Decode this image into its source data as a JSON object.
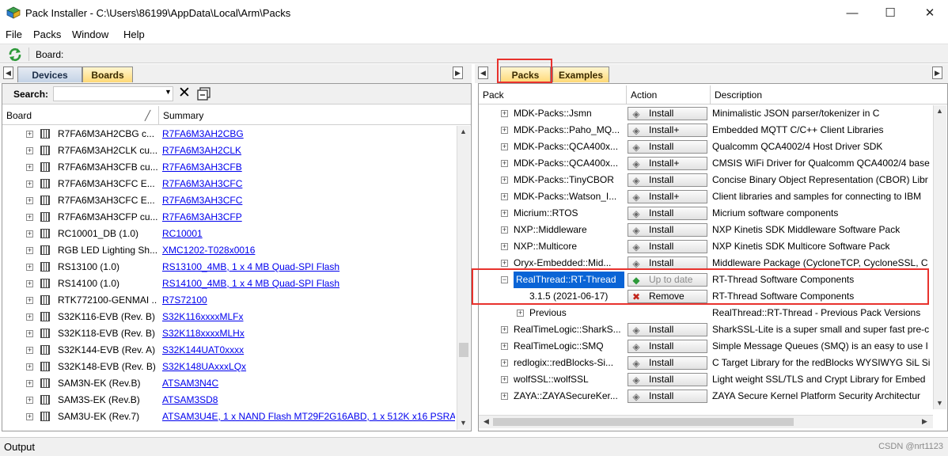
{
  "window": {
    "title": "Pack Installer - C:\\Users\\86199\\AppData\\Local\\Arm\\Packs",
    "minimize": "—",
    "maximize": "☐",
    "close": "✕"
  },
  "menu": [
    "File",
    "Packs",
    "Window",
    "Help"
  ],
  "toolbar": {
    "board_label": "Board:"
  },
  "left_pane": {
    "tabs": [
      "Devices",
      "Boards"
    ],
    "active_tab": "Boards",
    "search_label": "Search:",
    "search_value": "",
    "columns": [
      "Board",
      "Summary"
    ],
    "rows": [
      {
        "board": "R7FA6M3AH2CBG c...",
        "summary": "R7FA6M3AH2CBG"
      },
      {
        "board": "R7FA6M3AH2CLK cu...",
        "summary": "R7FA6M3AH2CLK"
      },
      {
        "board": "R7FA6M3AH3CFB cu...",
        "summary": "R7FA6M3AH3CFB"
      },
      {
        "board": "R7FA6M3AH3CFC E...",
        "summary": "R7FA6M3AH3CFC"
      },
      {
        "board": "R7FA6M3AH3CFC E...",
        "summary": "R7FA6M3AH3CFC"
      },
      {
        "board": "R7FA6M3AH3CFP cu...",
        "summary": "R7FA6M3AH3CFP"
      },
      {
        "board": "RC10001_DB (1.0)",
        "summary": "RC10001"
      },
      {
        "board": "RGB LED Lighting Sh...",
        "summary": "XMC1202-T028x0016"
      },
      {
        "board": "RS13100 (1.0)",
        "summary": "RS13100_4MB, 1 x 4 MB Quad-SPI Flash"
      },
      {
        "board": "RS14100 (1.0)",
        "summary": "RS14100_4MB, 1 x 4 MB Quad-SPI Flash"
      },
      {
        "board": "RTK772100-GENMAI ...",
        "summary": "R7S72100"
      },
      {
        "board": "S32K116-EVB (Rev. B)",
        "summary": "S32K116xxxxMLFx"
      },
      {
        "board": "S32K118-EVB (Rev. B)",
        "summary": "S32K118xxxxMLHx"
      },
      {
        "board": "S32K144-EVB (Rev. A)",
        "summary": "S32K144UAT0xxxx"
      },
      {
        "board": "S32K148-EVB (Rev. B)",
        "summary": "S32K148UAxxxLQx"
      },
      {
        "board": "SAM3N-EK (Rev.B)",
        "summary": "ATSAM3N4C"
      },
      {
        "board": "SAM3S-EK (Rev.B)",
        "summary": "ATSAM3SD8"
      },
      {
        "board": "SAM3U-EK (Rev.7)",
        "summary": "ATSAM3U4E, 1 x NAND Flash MT29F2G16ABD, 1 x 512K x16 PSRA..."
      }
    ]
  },
  "right_pane": {
    "tabs": [
      "Packs",
      "Examples"
    ],
    "active_tab": "Packs",
    "columns": [
      "Pack",
      "Action",
      "Description"
    ],
    "rows": [
      {
        "pack": "MDK-Packs::Jsmn",
        "action": "Install",
        "description": "Minimalistic JSON parser/tokenizer in C"
      },
      {
        "pack": "MDK-Packs::Paho_MQ...",
        "action": "Install+",
        "description": "Embedded MQTT C/C++ Client Libraries"
      },
      {
        "pack": "MDK-Packs::QCA400x...",
        "action": "Install",
        "description": "Qualcomm QCA4002/4 Host Driver SDK"
      },
      {
        "pack": "MDK-Packs::QCA400x...",
        "action": "Install+",
        "description": "CMSIS WiFi Driver for Qualcomm QCA4002/4 base"
      },
      {
        "pack": "MDK-Packs::TinyCBOR",
        "action": "Install",
        "description": "Concise Binary Object Representation (CBOR) Libr"
      },
      {
        "pack": "MDK-Packs::Watson_I...",
        "action": "Install+",
        "description": "Client libraries and samples for connecting to IBM"
      },
      {
        "pack": "Micrium::RTOS",
        "action": "Install",
        "description": "Micrium software components"
      },
      {
        "pack": "NXP::Middleware",
        "action": "Install",
        "description": "NXP Kinetis SDK Middleware Software Pack"
      },
      {
        "pack": "NXP::Multicore",
        "action": "Install",
        "description": "NXP Kinetis SDK Multicore Software Pack"
      },
      {
        "pack": "Oryx-Embedded::Mid...",
        "action": "Install",
        "description": "Middleware Package (CycloneTCP, CycloneSSL, C"
      },
      {
        "pack": "RealThread::RT-Thread",
        "action": "Up to date",
        "description": "RT-Thread Software Components"
      },
      {
        "pack": "3.1.5 (2021-06-17)",
        "action": "Remove",
        "description": "RT-Thread Software Components"
      },
      {
        "pack": "Previous",
        "action": "",
        "description": "RealThread::RT-Thread - Previous Pack Versions"
      },
      {
        "pack": "RealTimeLogic::SharkS...",
        "action": "Install",
        "description": "SharkSSL-Lite is a super small and super fast pre-c"
      },
      {
        "pack": "RealTimeLogic::SMQ",
        "action": "Install",
        "description": "Simple Message Queues (SMQ) is an easy to use I"
      },
      {
        "pack": "redlogix::redBlocks-Si...",
        "action": "Install",
        "description": "C Target Library for the redBlocks WYSIWYG SiL Si"
      },
      {
        "pack": "wolfSSL::wolfSSL",
        "action": "Install",
        "description": "Light weight SSL/TLS and Crypt Library for Embed"
      },
      {
        "pack": "ZAYA::ZAYASecureKer...",
        "action": "Install",
        "description": "ZAYA Secure Kernel Platform Security Architectur"
      }
    ]
  },
  "statusbar": {
    "output_label": "Output",
    "watermark": "CSDN @nrt1123"
  },
  "colors": {
    "highlight_red": "#e8322d",
    "link_blue": "#0000ee",
    "selected_blue": "#0a64d6"
  }
}
